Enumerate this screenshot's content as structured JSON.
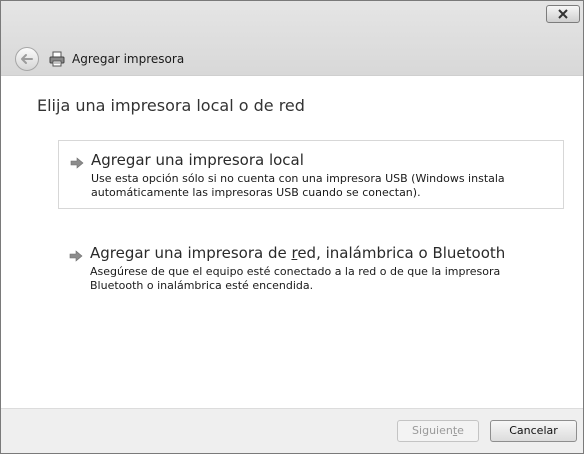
{
  "window": {
    "title": "Agregar impresora"
  },
  "heading": "Elija una impresora local o de red",
  "options": [
    {
      "title": "Agregar una impresora local",
      "description_line1": "Use esta opción sólo si no cuenta con una impresora USB (Windows instala",
      "description_line2": "automáticamente las impresoras USB cuando se conectan)."
    },
    {
      "title_before": "Agregar una impresora de ",
      "title_accel": "r",
      "title_after": "ed, inalámbrica o Bluetooth",
      "description_line1": "Asegúrese de que el equipo esté conectado a la red o de que la impresora",
      "description_line2": "Bluetooth o inalámbrica esté encendida."
    }
  ],
  "footer": {
    "next_before": "Siguien",
    "next_accel": "t",
    "next_after": "e",
    "cancel_label": "Cancelar"
  },
  "icons": {
    "close": "close-icon",
    "back": "back-arrow-icon",
    "printer": "printer-icon",
    "option_arrow": "green-arrow-icon"
  },
  "colors": {
    "titlebar": "#dcdcdc",
    "footer": "#efefef",
    "heading_text": "#333333"
  }
}
